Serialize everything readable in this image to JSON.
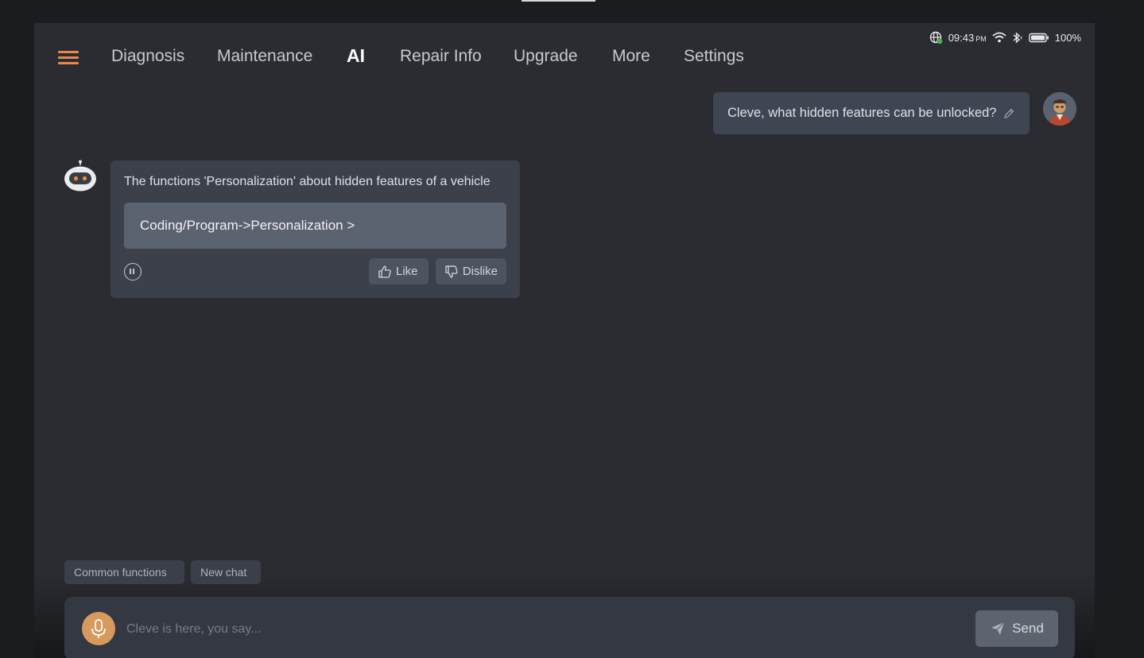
{
  "status": {
    "time": "09:43",
    "ampm": "PM",
    "battery": "100%"
  },
  "nav": {
    "tabs": [
      {
        "label": "Diagnosis"
      },
      {
        "label": "Maintenance"
      },
      {
        "label": "AI"
      },
      {
        "label": "Repair Info"
      },
      {
        "label": "Upgrade"
      },
      {
        "label": "More"
      },
      {
        "label": "Settings"
      }
    ],
    "active": "AI"
  },
  "chat": {
    "user_message": "Cleve, what hidden features can be unlocked?",
    "bot_message": "The functions 'Personalization' about hidden features of a vehicle",
    "bot_link": "Coding/Program->Personalization >",
    "like_label": "Like",
    "dislike_label": "Dislike"
  },
  "chips": {
    "common": "Common functions",
    "new_chat": "New chat"
  },
  "input": {
    "placeholder": "Cleve is here, you say...",
    "send_label": "Send"
  },
  "colors": {
    "accent": "#e8894a",
    "background": "#2b2c31",
    "bubble": "#3f4552"
  },
  "icons": [
    "menu-icon",
    "globe-icon",
    "wifi-icon",
    "bluetooth-icon",
    "battery-icon",
    "edit-icon",
    "robot-icon",
    "pause-icon",
    "thumbs-up-icon",
    "thumbs-down-icon",
    "microphone-icon",
    "send-icon"
  ]
}
